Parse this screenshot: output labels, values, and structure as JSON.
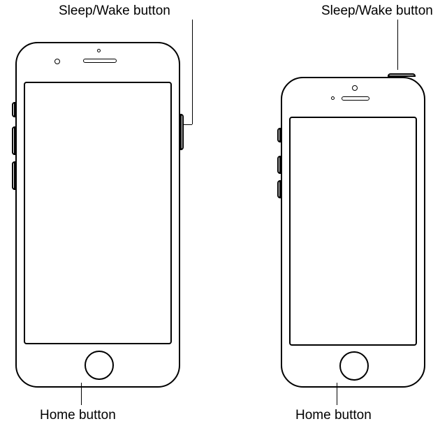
{
  "labels": {
    "left_sleep_wake": "Sleep/Wake button",
    "right_sleep_wake": "Sleep/Wake button",
    "left_home": "Home button",
    "right_home": "Home button"
  },
  "devices": [
    {
      "name": "iphone-side-button-right",
      "sleep_wake_location": "right-side",
      "has_home_button": true
    },
    {
      "name": "iphone-side-button-top",
      "sleep_wake_location": "top-edge",
      "has_home_button": true
    }
  ]
}
